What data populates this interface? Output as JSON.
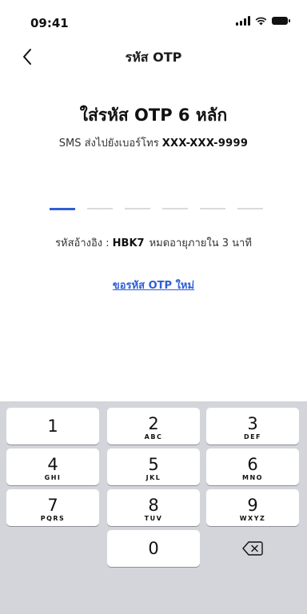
{
  "status_bar": {
    "time": "09:41"
  },
  "nav": {
    "title": "รหัส OTP"
  },
  "heading": "ใส่รหัส OTP 6 หลัก",
  "subtitle": {
    "text": "SMS ส่งไปยังเบอร์โทร",
    "phone": "XXX-XXX-9999"
  },
  "otp": {
    "length": 6,
    "active_index": 0
  },
  "reference": {
    "label": "รหัสอ้างอิง :",
    "code": "HBK7",
    "expiry": "หมดอายุภายใน 3 นาที"
  },
  "resend_label": "ขอรหัส OTP ใหม่",
  "keypad": {
    "keys": [
      {
        "num": "1",
        "letters": ""
      },
      {
        "num": "2",
        "letters": "ABC"
      },
      {
        "num": "3",
        "letters": "DEF"
      },
      {
        "num": "4",
        "letters": "GHI"
      },
      {
        "num": "5",
        "letters": "JKL"
      },
      {
        "num": "6",
        "letters": "MNO"
      },
      {
        "num": "7",
        "letters": "PQRS"
      },
      {
        "num": "8",
        "letters": "TUV"
      },
      {
        "num": "9",
        "letters": "WXYZ"
      },
      {
        "num": "0",
        "letters": ""
      }
    ]
  },
  "colors": {
    "accent": "#2f5fd6",
    "keypad_bg": "#d3d5da",
    "slot_inactive": "#d9dadd"
  }
}
